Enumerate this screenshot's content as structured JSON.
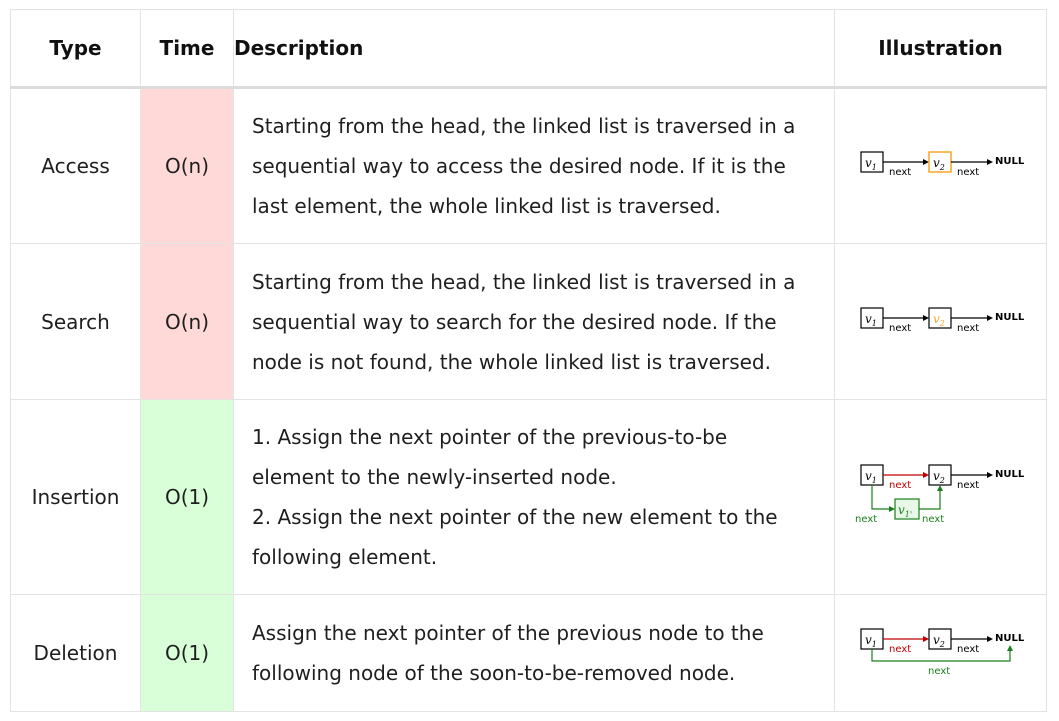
{
  "table": {
    "headers": {
      "type": "Type",
      "time": "Time",
      "description": "Description",
      "illustration": "Illustration"
    },
    "rows": [
      {
        "type": "Access",
        "time": "O(n)",
        "time_color": "#ffd8d8",
        "description": [
          "Starting from the head, the linked list is traversed in a",
          "sequential way to access the desired node. If it is the",
          "last element, the whole linked list is traversed."
        ]
      },
      {
        "type": "Search",
        "time": "O(n)",
        "time_color": "#ffd8d8",
        "description": [
          "Starting from the head, the linked list is traversed in a",
          "sequential way to search for the desired node. If the",
          "node is not found, the whole linked list is traversed."
        ]
      },
      {
        "type": "Insertion",
        "time": "O(1)",
        "time_color": "#d8ffd8",
        "description": [
          "1. Assign the next pointer of the previous-to-be",
          "element to the newly-inserted node.",
          "2. Assign the next pointer of the new element to the",
          "following element."
        ]
      },
      {
        "type": "Deletion",
        "time": "O(1)",
        "time_color": "#d8ffd8",
        "description": [
          "Assign the next pointer of the previous node to the",
          "following node of the soon-to-be-removed node."
        ]
      }
    ]
  },
  "diagram": {
    "node1": "v",
    "node1_sub": "1",
    "node2": "v",
    "node2_sub": "2",
    "new_node": "v",
    "new_node_sub": "1'",
    "pointer": "next",
    "null_label": "NULL",
    "colors": {
      "highlight_orange": "#f5a623",
      "pointer_red": "#c00000",
      "pointer_green": "#1a7f1a",
      "node_green_fill": "#e8f7e8"
    }
  }
}
